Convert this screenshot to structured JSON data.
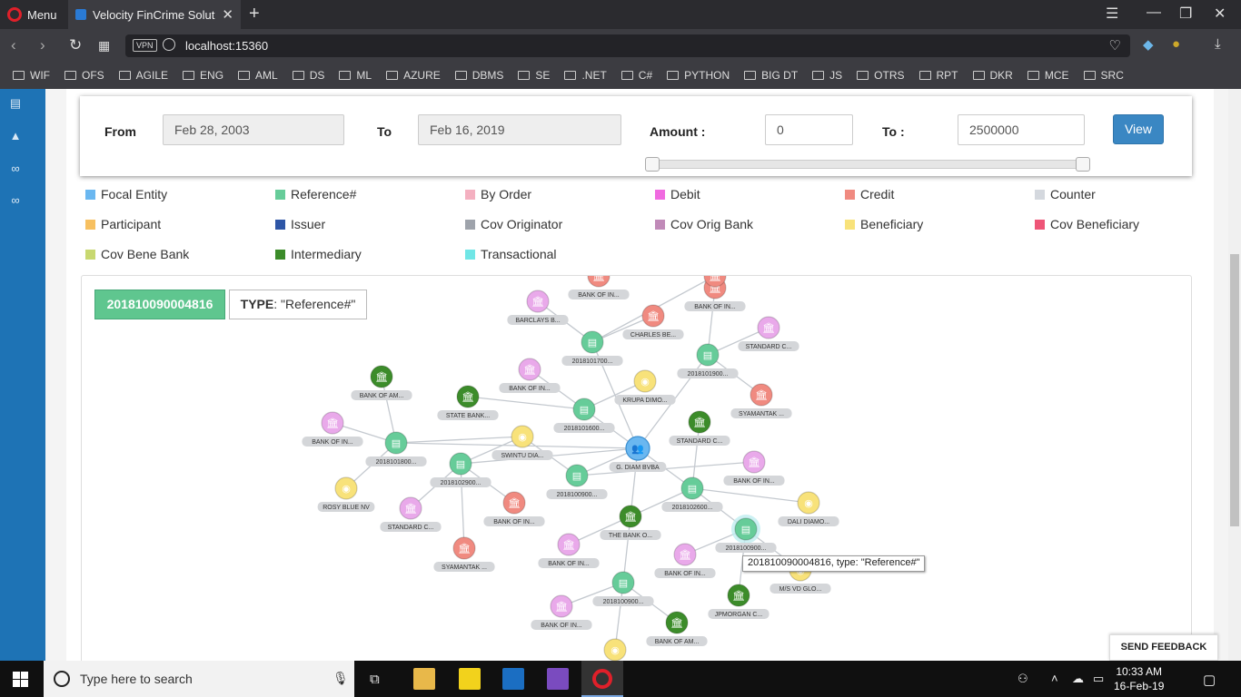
{
  "browser": {
    "menu_label": "Menu",
    "tab_title": "Velocity FinCrime Solution",
    "vpn": "VPN",
    "url": "localhost:15360",
    "bookmarks": [
      "WIF",
      "OFS",
      "AGILE",
      "ENG",
      "AML",
      "DS",
      "ML",
      "AZURE",
      "DBMS",
      "SE",
      ".NET",
      "C#",
      "PYTHON",
      "BIG DT",
      "JS",
      "OTRS",
      "RPT",
      "DKR",
      "MCE",
      "SRC"
    ]
  },
  "filter": {
    "from_label": "From",
    "from_value": "Feb 28, 2003",
    "to_label": "To",
    "to_value": "Feb 16, 2019",
    "amount_label": "Amount :",
    "amount_min": "0",
    "amount_to_label": "To :",
    "amount_max": "2500000",
    "view_label": "View",
    "slider_range": [
      0,
      1
    ]
  },
  "legend": [
    {
      "label": "Focal Entity",
      "color": "#6ab7f0"
    },
    {
      "label": "Reference#",
      "color": "#66cc99"
    },
    {
      "label": "By Order",
      "color": "#f4b0c0"
    },
    {
      "label": "Debit",
      "color": "#f06ae0"
    },
    {
      "label": "Credit",
      "color": "#f08a80"
    },
    {
      "label": "Counter",
      "color": "#d4d8de"
    },
    {
      "label": "Participant",
      "color": "#f7c060"
    },
    {
      "label": "Issuer",
      "color": "#2e56a6"
    },
    {
      "label": "Cov Originator",
      "color": "#9ea3ab"
    },
    {
      "label": "Cov Orig Bank",
      "color": "#c08ab8"
    },
    {
      "label": "Beneficiary",
      "color": "#f8e27a"
    },
    {
      "label": "Cov Beneficiary",
      "color": "#ee5577"
    },
    {
      "label": "Cov Bene Bank",
      "color": "#c8d870"
    },
    {
      "label": "Intermediary",
      "color": "#3c8c2a"
    },
    {
      "label": "Transactional",
      "color": "#70e6e6"
    }
  ],
  "selection": {
    "id": "201810090004816",
    "type_key": "TYPE",
    "type_value": ": \"Reference#\""
  },
  "graph": {
    "nodes": [
      {
        "label": "G. DIAM BVBA",
        "kind": "focal"
      },
      {
        "label": "2018101700...",
        "kind": "reference"
      },
      {
        "label": "2018101900...",
        "kind": "reference"
      },
      {
        "label": "2018101600...",
        "kind": "reference"
      },
      {
        "label": "2018101800...",
        "kind": "reference"
      },
      {
        "label": "2018102900...",
        "kind": "reference"
      },
      {
        "label": "2018100900...",
        "kind": "reference"
      },
      {
        "label": "2018102600...",
        "kind": "reference"
      },
      {
        "label": "2018100900...",
        "kind": "reference-selected"
      },
      {
        "label": "2018100900...",
        "kind": "reference"
      },
      {
        "label": "BANK OF IN...",
        "kind": "credit"
      },
      {
        "label": "BARCLAYS B...",
        "kind": "byorder"
      },
      {
        "label": "CHARLES BE...",
        "kind": "credit"
      },
      {
        "label": "BANK OF IN...",
        "kind": "credit"
      },
      {
        "label": "STANDARD C...",
        "kind": "byorder"
      },
      {
        "label": "SYAMANTAK ...",
        "kind": "credit"
      },
      {
        "label": "BANK OF IN...",
        "kind": "byorder"
      },
      {
        "label": "KRUPA DIMO...",
        "kind": "beneficiary"
      },
      {
        "label": "STATE BANK...",
        "kind": "intermediary"
      },
      {
        "label": "BANK OF AM...",
        "kind": "intermediary"
      },
      {
        "label": "BANK OF IN...",
        "kind": "byorder"
      },
      {
        "label": "SWINTU DIA...",
        "kind": "beneficiary"
      },
      {
        "label": "STANDARD C...",
        "kind": "intermediary"
      },
      {
        "label": "BANK OF IN...",
        "kind": "byorder"
      },
      {
        "label": "ROSY BLUE NV",
        "kind": "beneficiary"
      },
      {
        "label": "STANDARD C...",
        "kind": "byorder"
      },
      {
        "label": "BANK OF IN...",
        "kind": "credit"
      },
      {
        "label": "SYAMANTAK ...",
        "kind": "credit"
      },
      {
        "label": "THE BANK O...",
        "kind": "intermediary"
      },
      {
        "label": "DALI DIAMO...",
        "kind": "beneficiary"
      },
      {
        "label": "BANK OF IN...",
        "kind": "byorder"
      },
      {
        "label": "BANK OF IN...",
        "kind": "byorder"
      },
      {
        "label": "M/S VD GLO...",
        "kind": "beneficiary"
      },
      {
        "label": "JPMORGAN C...",
        "kind": "intermediary"
      },
      {
        "label": "BANK OF IN...",
        "kind": "byorder"
      },
      {
        "label": "BANK OF AM...",
        "kind": "intermediary"
      },
      {
        "label": "",
        "kind": "beneficiary"
      },
      {
        "label": "",
        "kind": "credit"
      }
    ],
    "edges": [
      [
        0,
        1
      ],
      [
        0,
        2
      ],
      [
        0,
        3
      ],
      [
        0,
        4
      ],
      [
        0,
        5
      ],
      [
        0,
        6
      ],
      [
        0,
        7
      ],
      [
        0,
        28
      ],
      [
        1,
        37
      ],
      [
        1,
        11
      ],
      [
        1,
        12
      ],
      [
        2,
        13
      ],
      [
        2,
        14
      ],
      [
        2,
        15
      ],
      [
        3,
        16
      ],
      [
        3,
        17
      ],
      [
        3,
        18
      ],
      [
        4,
        19
      ],
      [
        4,
        20
      ],
      [
        4,
        24
      ],
      [
        4,
        21
      ],
      [
        5,
        25
      ],
      [
        5,
        26
      ],
      [
        5,
        27
      ],
      [
        5,
        21
      ],
      [
        6,
        23
      ],
      [
        6,
        21
      ],
      [
        7,
        22
      ],
      [
        7,
        30
      ],
      [
        7,
        29
      ],
      [
        7,
        8
      ],
      [
        8,
        31
      ],
      [
        8,
        32
      ],
      [
        8,
        33
      ],
      [
        28,
        9
      ],
      [
        9,
        34
      ],
      [
        9,
        35
      ],
      [
        9,
        36
      ]
    ],
    "tooltip": "201810090004816, type: \"Reference#\""
  },
  "feedback_label": "SEND FEEDBACK",
  "taskbar": {
    "search_placeholder": "Type here to search",
    "time": "10:33 AM",
    "date": "16-Feb-19"
  }
}
